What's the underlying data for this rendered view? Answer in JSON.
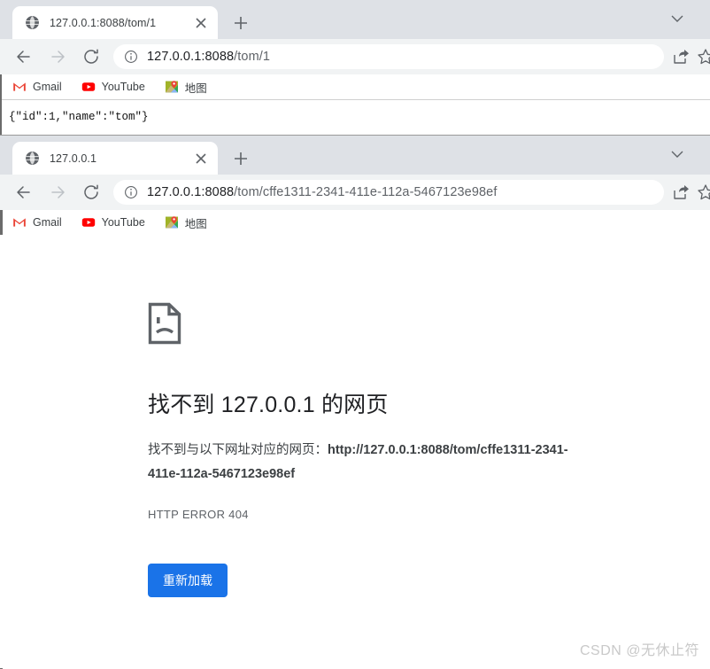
{
  "window_top": {
    "tab": {
      "favicon": "globe-icon",
      "title": "127.0.0.1:8088/tom/1",
      "close": "×"
    },
    "new_tab_label": "+",
    "toolbar": {
      "back": "back-arrow",
      "forward": "forward-arrow",
      "reload": "reload-arrow",
      "info": "info-circle",
      "url_host": "127.0.0.1:8088",
      "url_path": "/tom/1",
      "share": "share-icon",
      "star": "star-icon"
    },
    "bookmarks": [
      {
        "icon": "gmail-icon",
        "label": "Gmail"
      },
      {
        "icon": "youtube-icon",
        "label": "YouTube"
      },
      {
        "icon": "maps-icon",
        "label": "地图"
      }
    ],
    "body_text": "{\"id\":1,\"name\":\"tom\"}"
  },
  "window_bottom": {
    "tab": {
      "favicon": "globe-icon",
      "title": "127.0.0.1",
      "close": "×"
    },
    "new_tab_label": "+",
    "toolbar": {
      "back": "back-arrow",
      "forward": "forward-arrow",
      "reload": "reload-arrow",
      "info": "info-circle",
      "url_host": "127.0.0.1:8088",
      "url_path": "/tom/cffe1311-2341-411e-112a-5467123e98ef",
      "share": "share-icon",
      "star": "star-icon"
    },
    "bookmarks": [
      {
        "icon": "gmail-icon",
        "label": "Gmail"
      },
      {
        "icon": "youtube-icon",
        "label": "YouTube"
      },
      {
        "icon": "maps-icon",
        "label": "地图"
      }
    ],
    "error_page": {
      "icon": "sad-document-icon",
      "title": "找不到 127.0.0.1 的网页",
      "description_prefix": "找不到与以下网址对应的网页：",
      "description_url": "http://127.0.0.1:8088/tom/cffe1311-2341-411e-112a-5467123e98ef",
      "error_code": "HTTP ERROR 404",
      "reload_button": "重新加载",
      "accent_color": "#1a73e8"
    }
  },
  "watermark": "CSDN @无休止符"
}
